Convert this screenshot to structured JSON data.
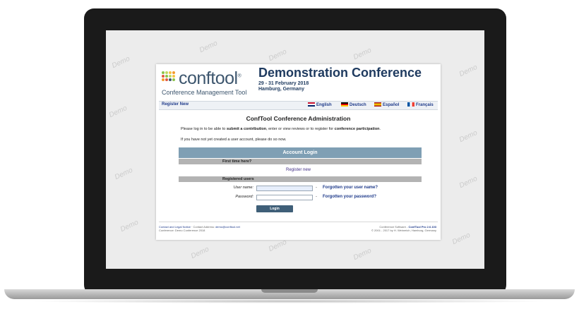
{
  "brand": {
    "logo_word": "conftool",
    "registered_mark": "®",
    "logo_subtitle": "Conference Management Tool",
    "dot_colors": [
      "#8bc34a",
      "#c0d860",
      "#f5c242",
      "#f39a2b",
      "#e2583e",
      "#8bc34a",
      "#c0d860",
      "#f5c242",
      "#f39a2b",
      "#e2583e",
      "#3d566e",
      "#8bc34a"
    ]
  },
  "conference": {
    "title": "Demonstration Conference",
    "dates": "29 - 31 February 2018",
    "location": "Hamburg, Germany"
  },
  "nav": {
    "register_new": "Register New",
    "languages": [
      {
        "label": "English",
        "flag": "uk-flag"
      },
      {
        "label": "Deutsch",
        "flag": "germany-flag"
      },
      {
        "label": "Español",
        "flag": "spain-flag"
      },
      {
        "label": "Français",
        "flag": "france-flag"
      }
    ]
  },
  "main": {
    "title": "ConfTool Conference Administration",
    "intro_pre": "Please log in to be able to ",
    "intro_bold1": "submit a contribution",
    "intro_mid": ", enter or view reviews or to register for ",
    "intro_bold2": "conference participation",
    "intro_end": ".",
    "no_account": "If you have not yet created a user account, please do so now."
  },
  "login": {
    "header": "Account Login",
    "first_time": "First time here?",
    "register_link": "Register new",
    "registered_users": "Registered users",
    "username_label": "User name:",
    "password_label": "Password:",
    "username_value": "",
    "password_value": "",
    "dash": "-",
    "forgot_username": "Forgotten your user name?",
    "forgot_password": "Forgotten your password?",
    "button": "Login"
  },
  "footer": {
    "contact_link": "Contact and Legal Notice",
    "contact_text": " · Contact Address: ",
    "contact_email": "demo@conftool.net",
    "conference_line": "Conference: Demo Conference 2018",
    "software_pre": "Conference Software - ",
    "software_name": "ConfTool Pro 2.6.103",
    "copyright": "© 2001 - 2017 by H. Weinreich, Hamburg, Germany"
  },
  "watermark": "Demo"
}
